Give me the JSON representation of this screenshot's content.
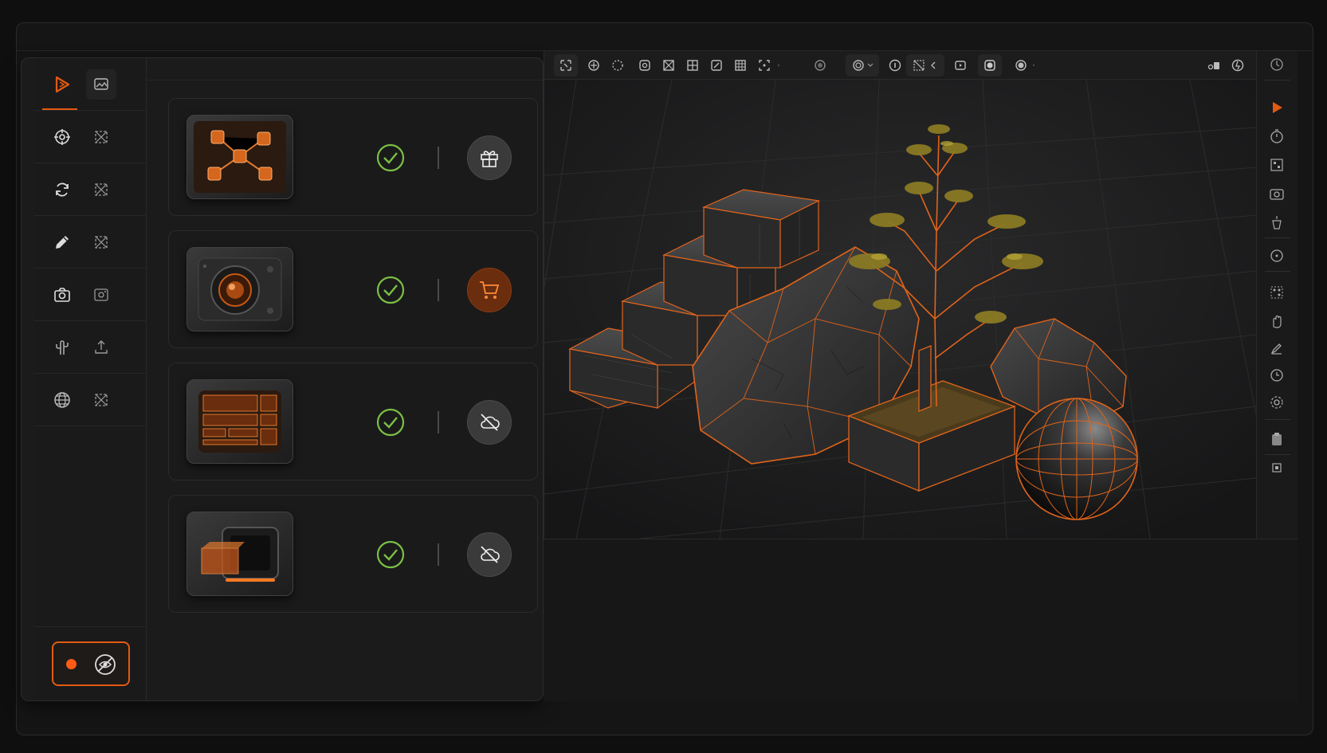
{
  "theme": {
    "accent": "#e35a12",
    "check": "#7bc043",
    "bg": "#151516"
  },
  "rail": {
    "rows": [
      {
        "left_icon": "play-logo-icon",
        "right_icon": "image-gallery-icon"
      },
      {
        "left_icon": "target-icon",
        "right_icon": "expand-icon"
      },
      {
        "left_icon": "sync-icon",
        "right_icon": "expand-icon"
      },
      {
        "left_icon": "pencil-icon",
        "right_icon": "expand-icon"
      },
      {
        "left_icon": "camera-icon",
        "right_icon": "screenshot-icon"
      },
      {
        "left_icon": "cactus-icon",
        "right_icon": "upload-icon"
      },
      {
        "left_icon": "globe-icon",
        "right_icon": "expand-icon"
      }
    ],
    "record": {
      "state": "recording",
      "icon": "eye-off-icon"
    }
  },
  "assets": [
    {
      "thumb": "node-graph-thumbnail",
      "status": "installed",
      "action_icon": "gift-icon",
      "action_color": "#3a3a3b"
    },
    {
      "thumb": "camera-lens-thumbnail",
      "status": "installed",
      "action_icon": "cart-icon",
      "action_color": "#6a2d0e"
    },
    {
      "thumb": "layout-grid-thumbnail",
      "status": "installed",
      "action_icon": "cloud-off-icon",
      "action_color": "#3a3a3b"
    },
    {
      "thumb": "box-extrude-thumbnail",
      "status": "installed",
      "action_icon": "cloud-off-icon",
      "action_color": "#3a3a3b"
    }
  ],
  "viewport": {
    "objects": [
      "stairs",
      "rock",
      "tree",
      "planter",
      "small-rock",
      "sphere"
    ]
  }
}
